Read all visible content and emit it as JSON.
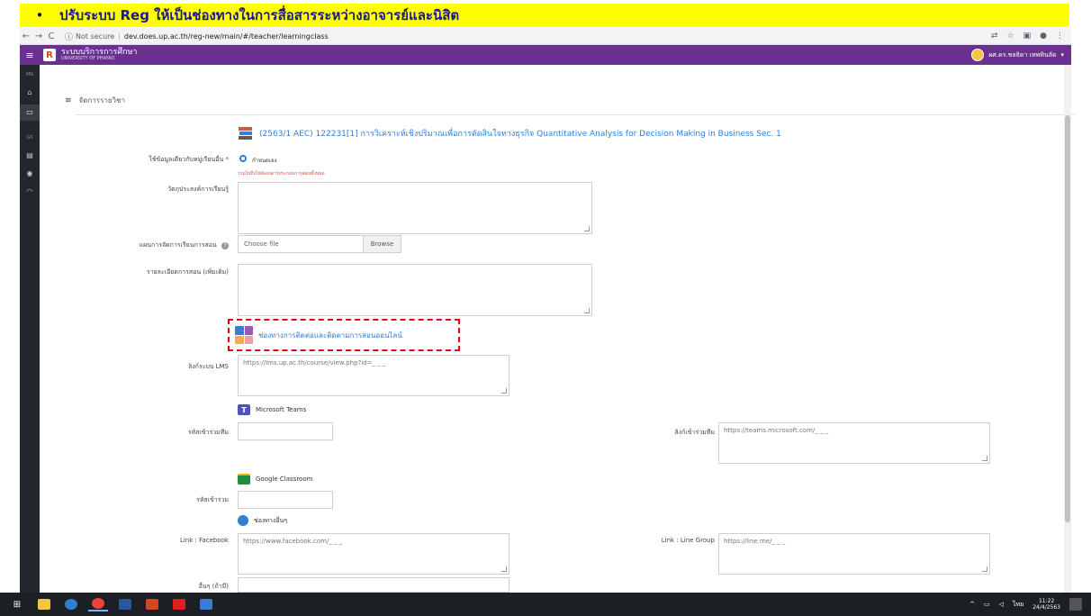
{
  "banner": {
    "bullet": "•",
    "text": "ปรับระบบ Reg ให้เป็นช่องทางในการสื่อสารระหว่างอาจารย์และนิสิต"
  },
  "browser": {
    "back": "←",
    "forward": "→",
    "reload": "C",
    "security": "Not secure",
    "url": "dev.does.up.ac.th/reg-new/main/#/teacher/learningclass"
  },
  "app": {
    "logo": "R",
    "title": "ระบบบริการการศึกษา",
    "subtitle": "UNIVERSITY OF PHAYAO",
    "user": "ผศ.ดร.ชลธิดา เทพทินลัด"
  },
  "rail": {
    "label_top": "MN",
    "label_mid": "GS"
  },
  "section": {
    "title": "จัดการรายวิชา"
  },
  "course": {
    "title": "(2563/1 AEC) 122231[1] การวิเคราะห์เชิงปริมาณเพื่อการตัดสินใจทางธุรกิจ Quantitative Analysis for Decision Making in Business Sec. 1"
  },
  "form": {
    "share_label": "ใช้ข้อมูลเดียวกับหมู่เรียนอื่น",
    "required_mark": "*",
    "share_option": "กำหนดเอง",
    "share_note": "รวมไปถึงไฟล์เอกสารประกอบการสอนทั้งหมด",
    "objective_label": "วัตถุประสงค์การเรียนรู้",
    "plan_label": "แผนการจัดการเรียนการสอน",
    "file_placeholder": "Choose file",
    "browse_label": "Browse",
    "detail_label": "รายละเอียดการสอน (เพิ่มเติม)",
    "online_heading": "ช่องทางการติดต่อและติดตามการสอนออนไลน์",
    "lms_label": "ลิงก์ระบบ LMS",
    "lms_value": "https://lms.up.ac.th/course/view.php?id=_ _ _",
    "teams_name": "Microsoft Teams",
    "teams_code_label": "รหัสเข้าร่วมทีม",
    "teams_link_label": "ลิงก์เข้าร่วมทีม",
    "teams_link_value": "https://teams.microsoft.com/_ _ _",
    "classroom_name": "Google Classroom",
    "classroom_code_label": "รหัสเข้าร่วม",
    "other_channels": "ช่องทางอื่นๆ",
    "facebook_label": "Link : Facebook",
    "facebook_value": "https://www.facebook.com/_ _ _",
    "line_label": "Link : Line Group",
    "line_value": "https://line.me/_ _ _",
    "other_label": "อื่นๆ (ถ้ามี)"
  },
  "taskbar": {
    "time": "11:22",
    "date": "24/4/2563",
    "lang": "ไทย"
  },
  "colors": {
    "banner_bg": "#ffff00",
    "appbar": "#6a3191",
    "link_blue": "#2f7fd3",
    "highlight_red": "#e3001b"
  }
}
